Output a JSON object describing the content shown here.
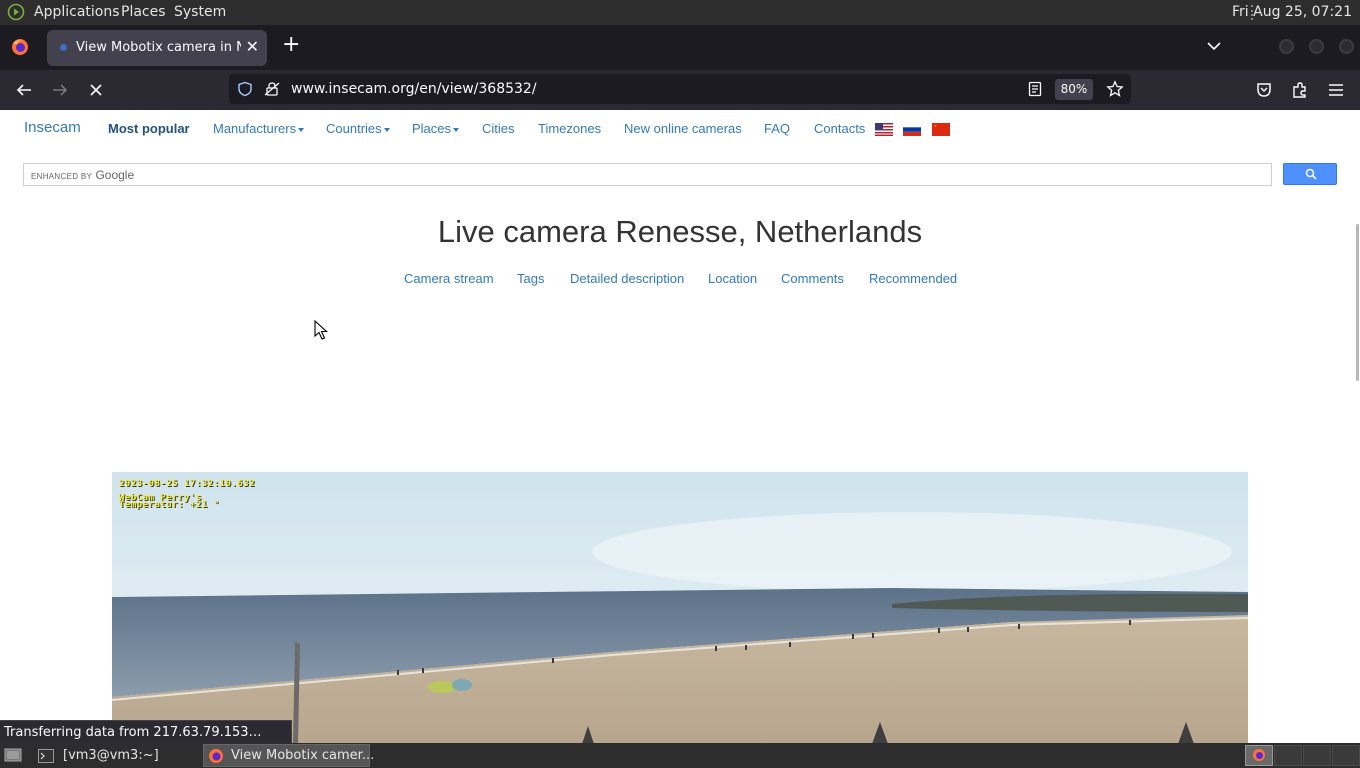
{
  "top_panel": {
    "applications": "Applications",
    "places": "Places",
    "system": "System",
    "clock": "Fri Aug 25, 07:21"
  },
  "browser": {
    "tab_title": "View Mobotix camera in Netherlands",
    "url": "www.insecam.org/en/view/368532/",
    "zoom": "80%",
    "status": "Transferring data from 217.63.79.153…"
  },
  "site": {
    "brand": "Insecam",
    "nav": {
      "most_popular": "Most popular",
      "manufacturers": "Manufacturers",
      "countries": "Countries",
      "places": "Places",
      "cities": "Cities",
      "timezones": "Timezones",
      "new_cameras": "New online cameras",
      "faq": "FAQ",
      "contacts": "Contacts"
    },
    "search": {
      "enhanced_by": "ENHANCED BY",
      "google": "Google"
    },
    "title": "Live camera Renesse, Netherlands",
    "subnav": {
      "stream": "Camera stream",
      "tags": "Tags",
      "description": "Detailed description",
      "location": "Location",
      "comments": "Comments",
      "recommended": "Recommended"
    },
    "camera_overlay": {
      "timestamp": "2023-08-25 17:32:10.632",
      "line2": "WebCam Perry's",
      "line3": "Temperatur: +21 °"
    }
  },
  "taskbar": {
    "terminal": "[vm3@vm3:~]",
    "firefox": "View Mobotix camer..."
  },
  "colors": {
    "link": "#337ab7",
    "panel": "#2d2d2d",
    "tabbar": "#1c1b22",
    "navbar": "#2b2a33",
    "search_button": "#4d90fe"
  }
}
